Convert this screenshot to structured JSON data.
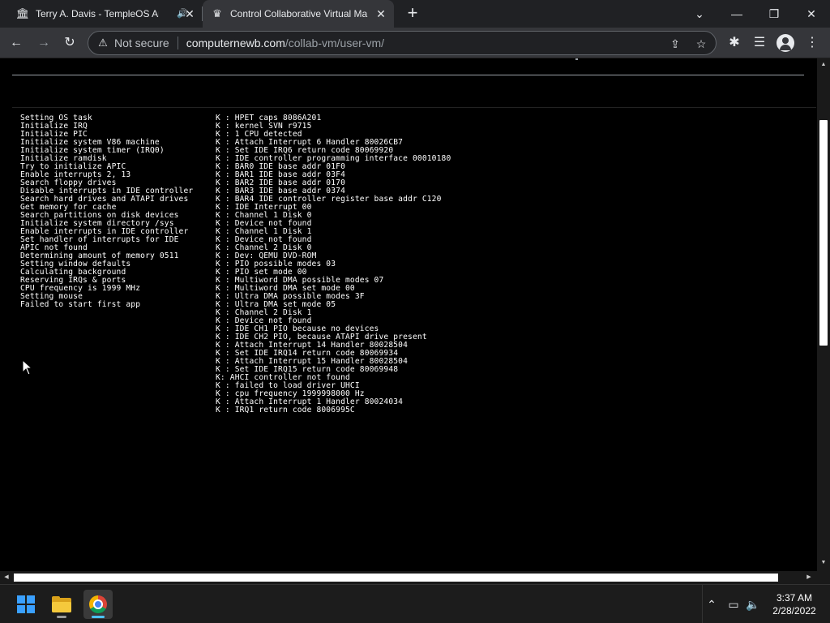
{
  "browser": {
    "tabs": [
      {
        "title": "Terry A. Davis - TempleOS Ar",
        "favicon": "museum-icon",
        "audio": "speaker-icon"
      },
      {
        "title": "Control Collaborative Virtual Ma",
        "favicon": "vm-icon",
        "active": true
      }
    ],
    "new_tab_label": "+",
    "window_controls": {
      "tab_list": "⌄",
      "minimize": "—",
      "restore": "❐",
      "close": "✕"
    },
    "toolbar": {
      "back": "←",
      "forward": "→",
      "reload": "↻",
      "security_icon": "⚠",
      "security_label": "Not secure",
      "url_host": "computernewb.com",
      "url_path": "/collab-vm/user-vm/",
      "share": "⇪",
      "bookmark": "☆",
      "extensions": "✱",
      "media": "☰",
      "menu": "⋮"
    }
  },
  "vm": {
    "left_lines": [
      "Setting OS task",
      "Initialize IRQ",
      "Initialize PIC",
      "Initialize system V86 machine",
      "Initialize system timer (IRQ0)",
      "Initialize ramdisk",
      "Try to initialize APIC",
      "Enable interrupts 2, 13",
      "Search floppy drives",
      "Disable interrupts in IDE controller",
      "Search hard drives and ATAPI drives",
      "Get memory for cache",
      "Search partitions on disk devices",
      "Initialize system directory /sys",
      "Enable interrupts in IDE controller",
      "Set handler of interrupts for IDE",
      "APIC not found",
      "Determining amount of memory 0511",
      "Setting window defaults",
      "Calculating background",
      "Reserving IRQs & ports",
      "CPU frequency is 1999 MHz",
      "Setting mouse",
      "Failed to start first app"
    ],
    "right_lines": [
      "K : HPET caps 8086A201",
      "K : kernel SVN r9715",
      "K : 1 CPU detected",
      "K : Attach Interrupt 6 Handler 80026CB7",
      "K : Set IDE IRQ6 return code 80069920",
      "K : IDE controller programming interface 00010180",
      "K : BAR0 IDE base addr 01F0",
      "K : BAR1 IDE base addr 03F4",
      "K : BAR2 IDE base addr 0170",
      "K : BAR3 IDE base addr 0374",
      "K : BAR4 IDE controller register base addr C120",
      "K : IDE Interrupt 00",
      "K : Channel 1 Disk 0",
      "K : Device not found",
      "K : Channel 1 Disk 1",
      "K : Device not found",
      "K : Channel 2 Disk 0",
      "K : Dev: QEMU DVD-ROM",
      "K : PIO possible modes 03",
      "K : PIO set mode 00",
      "K : Multiword DMA possible modes 07",
      "K : Multiword DMA set mode 00",
      "K : Ultra DMA possible modes 3F",
      "K : Ultra DMA set mode 05",
      "K : Channel 2 Disk 1",
      "K : Device not found",
      "K : IDE CH1 PIO because no devices",
      "K : IDE CH2 PIO, because ATAPI drive present",
      "K : Attach Interrupt 14 Handler 80028504",
      "K : Set IDE IRQ14 return code 80069934",
      "K : Attach Interrupt 15 Handler 80028504",
      "K : Set IDE IRQ15 return code 80069948",
      "K: AHCI controller not found",
      "K : failed to load driver UHCI",
      "K : cpu frequency 1999998000 Hz",
      "K : Attach Interrupt 1 Handler 80024034",
      "K : IRQ1 return code 8006995C"
    ]
  },
  "taskbar": {
    "apps": [
      {
        "name": "start",
        "icon": "windows-icon"
      },
      {
        "name": "file-explorer",
        "icon": "folder-icon"
      },
      {
        "name": "chrome",
        "icon": "chrome-icon",
        "active": true
      }
    ],
    "tray": {
      "overflow": "⌃",
      "network": "▭",
      "volume": "🔈",
      "time": "3:37 AM",
      "date": "2/28/2022"
    }
  },
  "colors": {
    "tab_strip": "#202124",
    "toolbar": "#35363a",
    "vm_background": "#000000",
    "vm_text": "#ffffff",
    "taskbar": "#1c1c1c",
    "accent": "#4cc2ff"
  }
}
